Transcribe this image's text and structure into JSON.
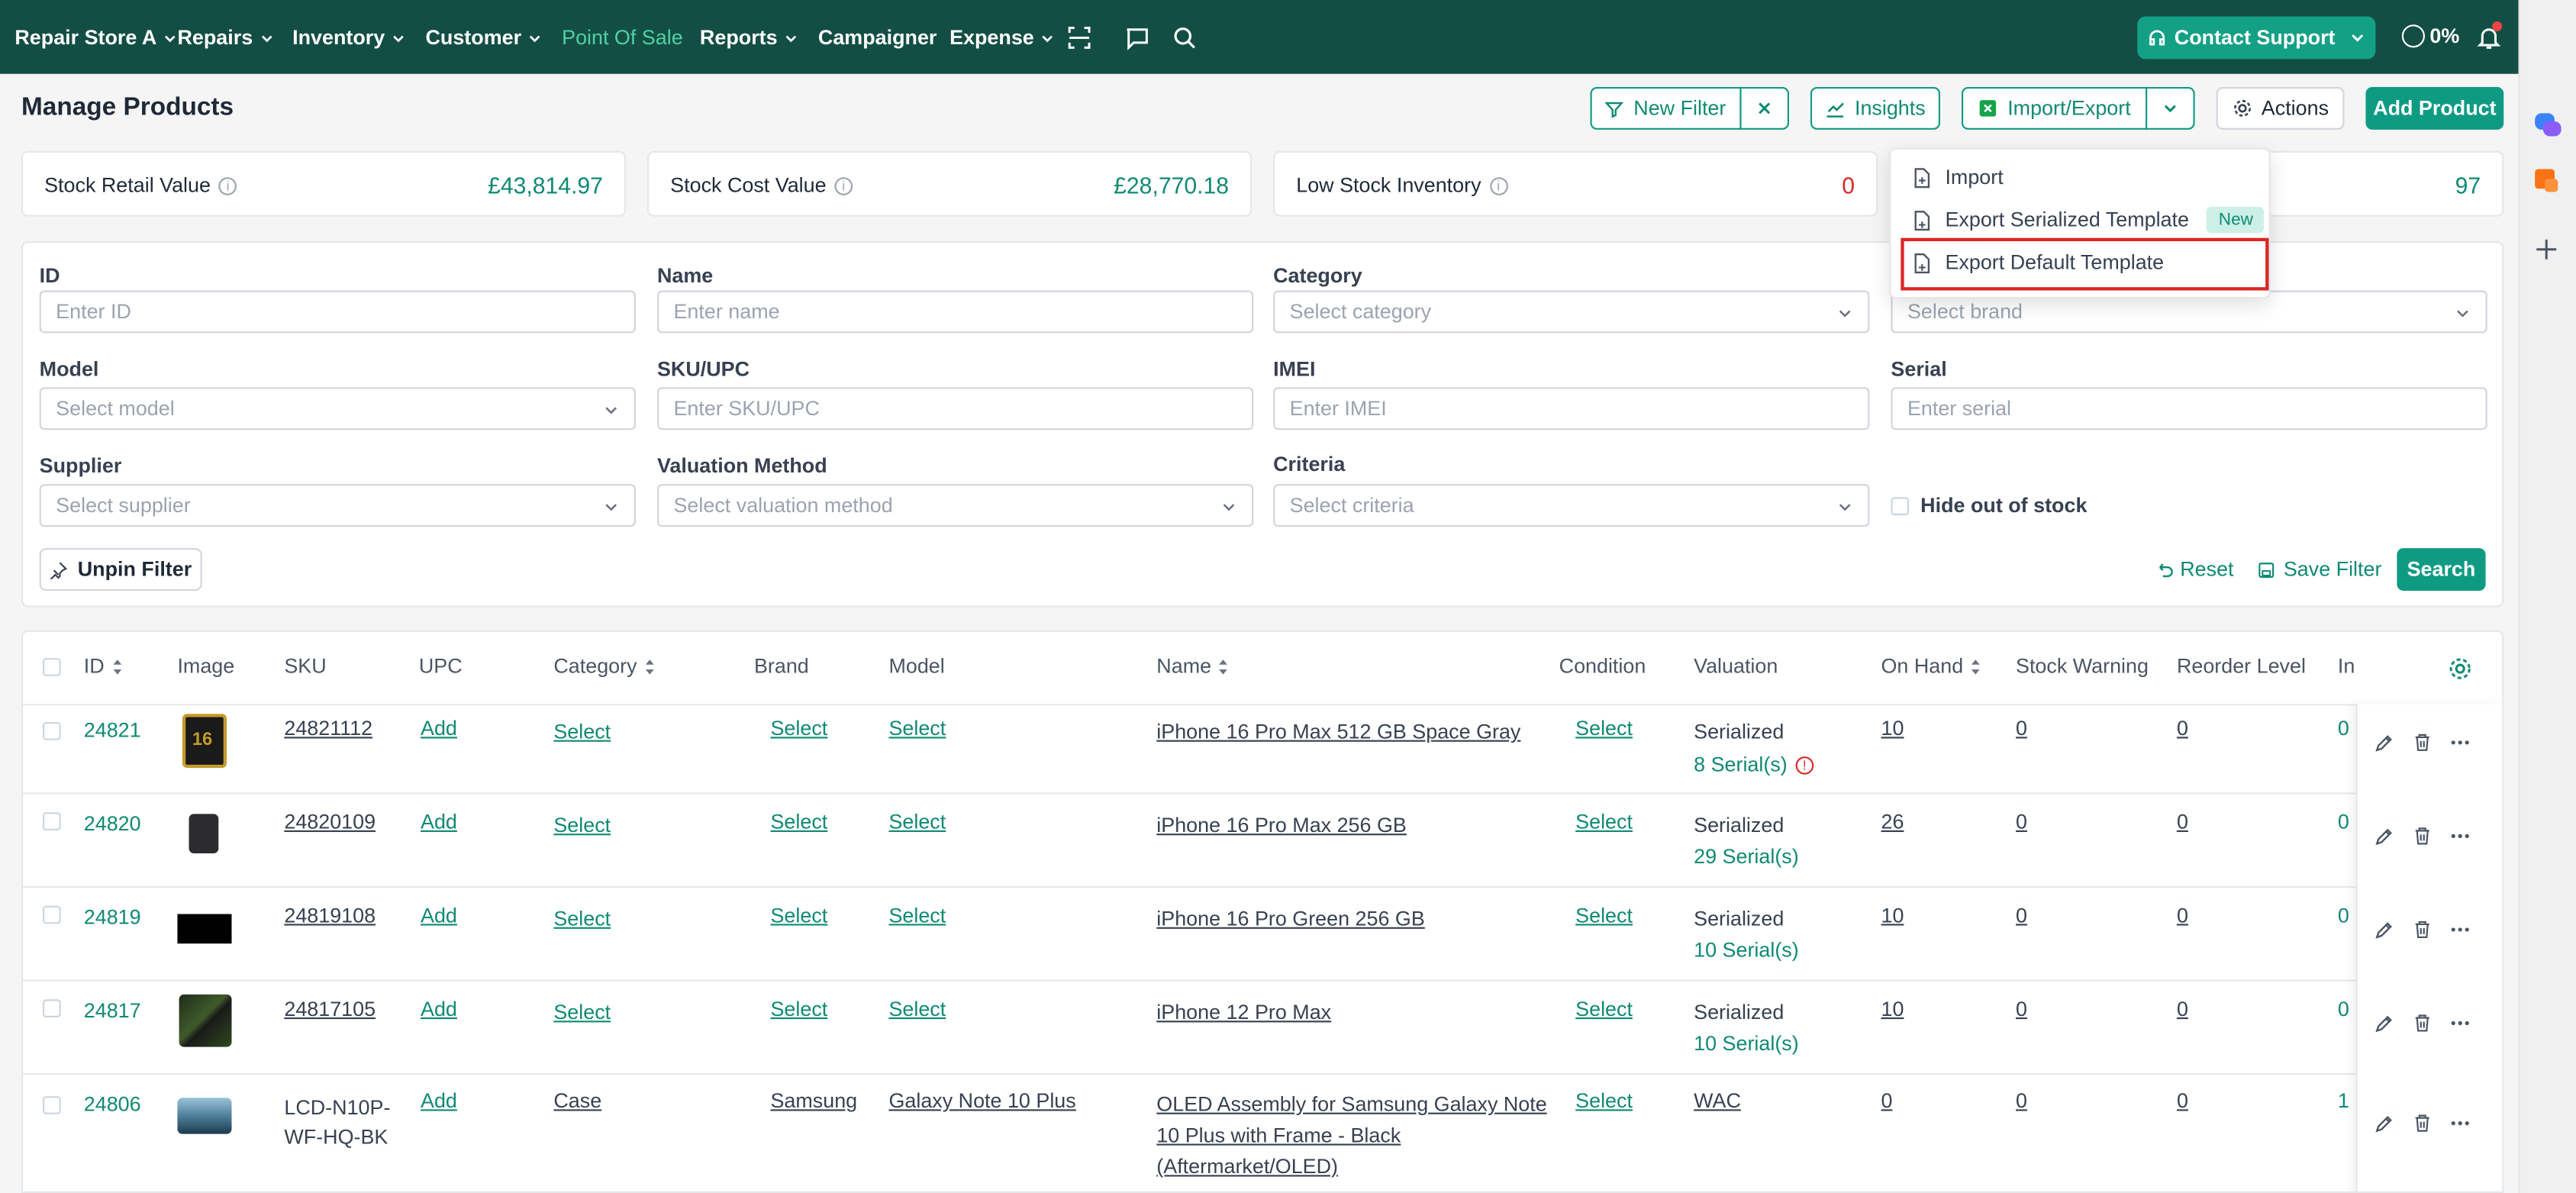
{
  "nav": {
    "store": "Repair Store A",
    "items": [
      "Repairs",
      "Inventory",
      "Customer"
    ],
    "pos": "Point Of Sale",
    "reports": "Reports",
    "campaigner": "Campaigner",
    "expense": "Expense",
    "contact": "Contact Support",
    "percent": "0%"
  },
  "page": {
    "title": "Manage Products"
  },
  "toolbar": {
    "new_filter": "New Filter",
    "insights": "Insights",
    "import_export": "Import/Export",
    "actions": "Actions",
    "add_product": "Add Product"
  },
  "stats": [
    {
      "label": "Stock Retail Value",
      "value": "£43,814.97"
    },
    {
      "label": "Stock Cost Value",
      "value": "£28,770.18"
    },
    {
      "label": "Low Stock Inventory",
      "value": "0"
    },
    {
      "label": "",
      "value": "97"
    }
  ],
  "menu": {
    "import": "Import",
    "export_serialized": "Export Serialized Template",
    "new_badge": "New",
    "export_default": "Export Default Template"
  },
  "filters": {
    "id": {
      "label": "ID",
      "placeholder": "Enter ID"
    },
    "name": {
      "label": "Name",
      "placeholder": "Enter name"
    },
    "category": {
      "label": "Category",
      "placeholder": "Select category"
    },
    "brand": {
      "placeholder": "Select brand"
    },
    "model": {
      "label": "Model",
      "placeholder": "Select model"
    },
    "sku": {
      "label": "SKU/UPC",
      "placeholder": "Enter SKU/UPC"
    },
    "imei": {
      "label": "IMEI",
      "placeholder": "Enter IMEI"
    },
    "serial": {
      "label": "Serial",
      "placeholder": "Enter serial"
    },
    "supplier": {
      "label": "Supplier",
      "placeholder": "Select supplier"
    },
    "valuation": {
      "label": "Valuation Method",
      "placeholder": "Select valuation method"
    },
    "criteria": {
      "label": "Criteria",
      "placeholder": "Select criteria"
    },
    "hide_oos": "Hide out of stock",
    "unpin": "Unpin Filter",
    "reset": "Reset",
    "save": "Save Filter",
    "search": "Search"
  },
  "table": {
    "headers": {
      "id": "ID",
      "image": "Image",
      "sku": "SKU",
      "upc": "UPC",
      "category": "Category",
      "brand": "Brand",
      "model": "Model",
      "name": "Name",
      "condition": "Condition",
      "valuation": "Valuation",
      "on_hand": "On Hand",
      "stock_warning": "Stock Warning",
      "reorder": "Reorder Level",
      "in": "In"
    },
    "rows": [
      {
        "id": "24821",
        "sku": "24821112",
        "upc": "Add",
        "category": "Select",
        "brand": "Select",
        "model": "Select",
        "name": "iPhone 16 Pro Max 512 GB Space Gray",
        "condition": "Select",
        "valuation": "Serialized",
        "serials": "8 Serial(s)",
        "on_hand": "10",
        "stock_warning": "0",
        "reorder": "0",
        "in": "0"
      },
      {
        "id": "24820",
        "sku": "24820109",
        "upc": "Add",
        "category": "Select",
        "brand": "Select",
        "model": "Select",
        "name": "iPhone 16 Pro Max 256 GB",
        "condition": "Select",
        "valuation": "Serialized",
        "serials": "29 Serial(s)",
        "on_hand": "26",
        "stock_warning": "0",
        "reorder": "0",
        "in": "0"
      },
      {
        "id": "24819",
        "sku": "24819108",
        "upc": "Add",
        "category": "Select",
        "brand": "Select",
        "model": "Select",
        "name": "iPhone 16 Pro Green 256 GB",
        "condition": "Select",
        "valuation": "Serialized",
        "serials": "10 Serial(s)",
        "on_hand": "10",
        "stock_warning": "0",
        "reorder": "0",
        "in": "0"
      },
      {
        "id": "24817",
        "sku": "24817105",
        "upc": "Add",
        "category": "Select",
        "brand": "Select",
        "model": "Select",
        "name": "iPhone 12 Pro Max",
        "condition": "Select",
        "valuation": "Serialized",
        "serials": "10 Serial(s)",
        "on_hand": "10",
        "stock_warning": "0",
        "reorder": "0",
        "in": "0"
      },
      {
        "id": "24806",
        "sku1": "LCD-N10P-",
        "sku2": "WF-HQ-BK",
        "upc": "Add",
        "category": "Case",
        "brand": "Samsung",
        "model": "Galaxy Note 10 Plus",
        "name1": "OLED Assembly for Samsung Galaxy Note",
        "name2": "10 Plus with Frame - Black",
        "name3": "(Aftermarket/OLED)",
        "condition": "Select",
        "valuation": "WAC",
        "on_hand": "0",
        "stock_warning": "0",
        "reorder": "0",
        "in": "1"
      }
    ]
  },
  "colors": {
    "nav": "#134e44",
    "accent": "#0f9b83",
    "danger": "#dc2626"
  }
}
